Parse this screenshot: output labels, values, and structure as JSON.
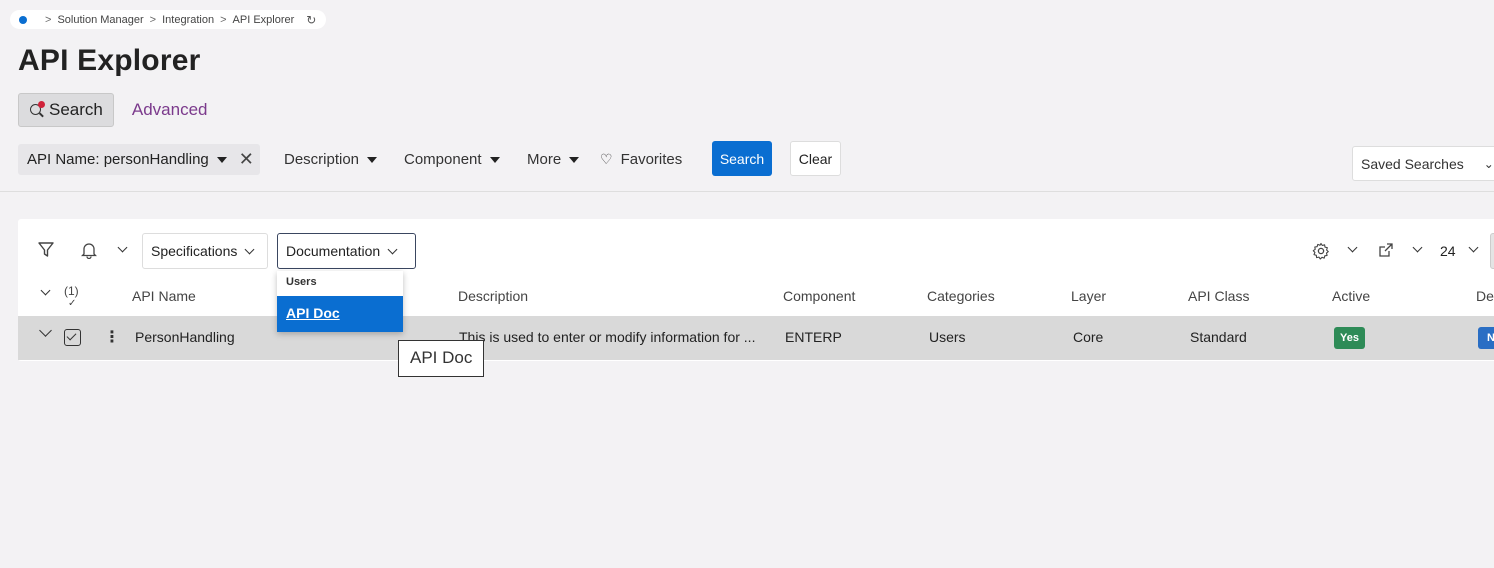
{
  "breadcrumb": {
    "items": [
      "Solution Manager",
      "Integration",
      "API Explorer"
    ]
  },
  "page": {
    "title": "API Explorer"
  },
  "mode_tabs": {
    "search": "Search",
    "advanced": "Advanced"
  },
  "filters": {
    "chip_label": "API Name: personHandling",
    "description": "Description",
    "component": "Component",
    "more": "More",
    "favorites": "Favorites",
    "search_button": "Search",
    "clear_button": "Clear",
    "saved_searches": "Saved Searches"
  },
  "toolbar": {
    "specifications": "Specifications",
    "documentation": "Documentation",
    "page_size": "24"
  },
  "documentation_menu": {
    "group": "Users",
    "item": "API Doc"
  },
  "tooltip": "API Doc",
  "table": {
    "selected_count": "(1)",
    "columns": [
      "API Name",
      "Description",
      "Component",
      "Categories",
      "Layer",
      "API Class",
      "Active",
      "De"
    ],
    "rows": [
      {
        "api_name": "PersonHandling",
        "description": "This is used to enter or modify information for ...",
        "component": "ENTERP",
        "categories": "Users",
        "layer": "Core",
        "api_class": "Standard",
        "active": "Yes",
        "deprecated": "N"
      }
    ]
  },
  "colors": {
    "accent": "#0a6ed1",
    "active_badge": "#2e8b57",
    "advanced_link": "#7b3a8c"
  }
}
